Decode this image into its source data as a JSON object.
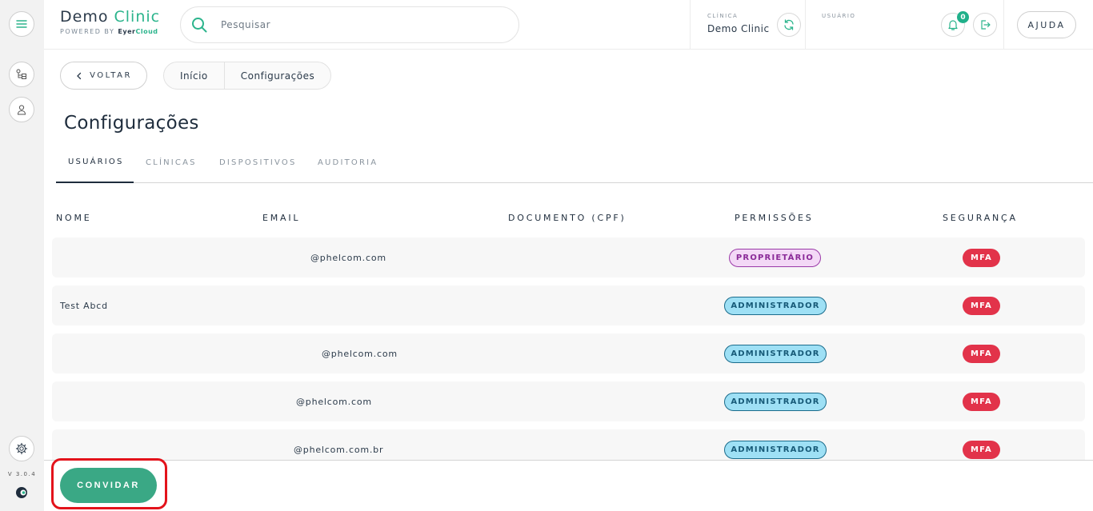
{
  "brand": {
    "name": "Demo",
    "name_accent": "Clinic",
    "powered_prefix": "POWERED BY",
    "powered_bold": "Eyer",
    "powered_accent": "Cloud"
  },
  "search": {
    "placeholder": "Pesquisar",
    "value": ""
  },
  "clinic": {
    "label": "CLÍNICA",
    "value": "Demo Clinic"
  },
  "user": {
    "label": "USUÁRIO"
  },
  "notifications": {
    "count": "0"
  },
  "help_label": "AJUDA",
  "sidebar": {
    "version": "V 3.0.4"
  },
  "nav": {
    "back_label": "VOLTAR",
    "breadcrumbs": [
      "Início",
      "Configurações"
    ]
  },
  "page": {
    "title": "Configurações"
  },
  "tabs": [
    "USUÁRIOS",
    "CLÍNICAS",
    "DISPOSITIVOS",
    "AUDITORIA"
  ],
  "table": {
    "headers": [
      "NOME",
      "EMAIL",
      "DOCUMENTO (CPF)",
      "PERMISSÕES",
      "SEGURANÇA"
    ],
    "rows": [
      {
        "name": "",
        "email": "@phelcom.com",
        "cpf": "",
        "permission": "PROPRIETÁRIO",
        "security": "MFA"
      },
      {
        "name": "Test Abcd",
        "email": "",
        "cpf": "",
        "permission": "ADMINISTRADOR",
        "security": "MFA"
      },
      {
        "name": "",
        "email": "@phelcom.com",
        "cpf": "",
        "permission": "ADMINISTRADOR",
        "security": "MFA"
      },
      {
        "name": "",
        "email": "@phelcom.com",
        "cpf": "",
        "permission": "ADMINISTRADOR",
        "security": "MFA"
      },
      {
        "name": "",
        "email": "@phelcom.com.br",
        "cpf": "",
        "permission": "ADMINISTRADOR",
        "security": "MFA"
      }
    ]
  },
  "footer": {
    "invite_label": "CONVIDAR"
  },
  "colors": {
    "accent": "#2bb48c",
    "button": "#3aa885",
    "owner": "#9b3aa8",
    "admin": "#9ee0f5",
    "mfa": "#e2334a",
    "highlight": "#e3131b"
  },
  "icons": [
    "menu-icon",
    "hierarchy-icon",
    "user-icon",
    "gear-icon",
    "search-icon",
    "refresh-icon",
    "bell-icon",
    "logout-icon",
    "chevron-left-icon",
    "eyercloud-logo-icon"
  ]
}
